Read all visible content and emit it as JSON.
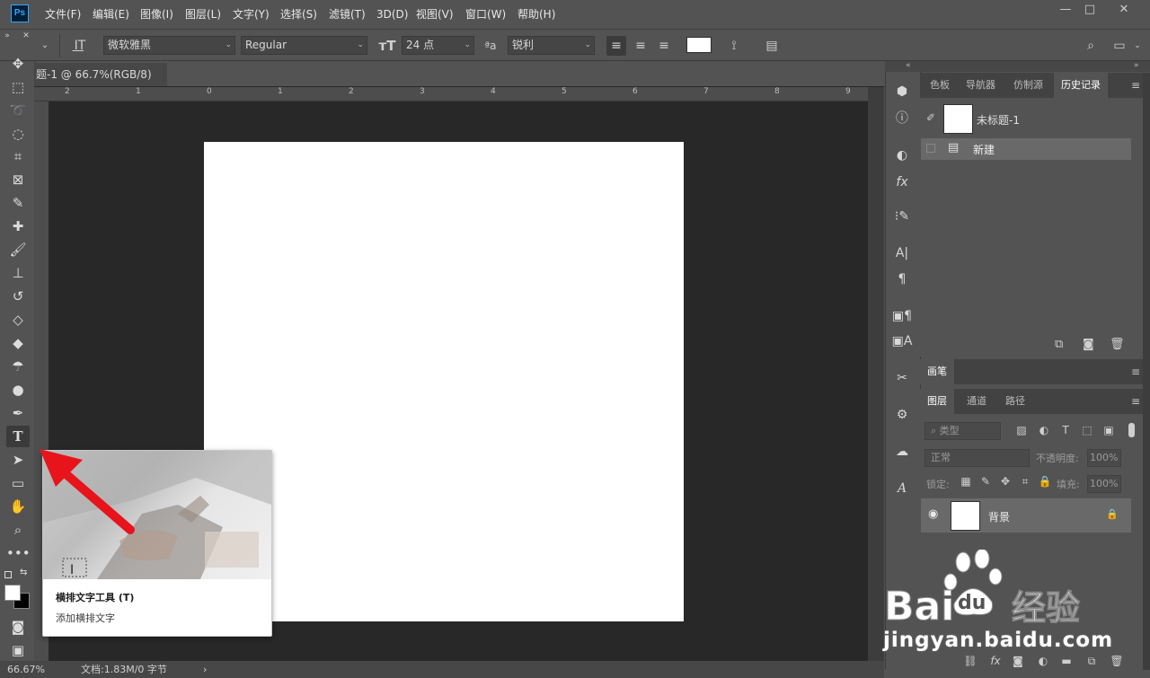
{
  "app": {
    "logo": "Ps"
  },
  "menu": [
    "文件(F)",
    "编辑(E)",
    "图像(I)",
    "图层(L)",
    "文字(Y)",
    "选择(S)",
    "滤镜(T)",
    "3D(D)",
    "视图(V)",
    "窗口(W)",
    "帮助(H)"
  ],
  "window_controls": {
    "minimize": "—",
    "restore": "□",
    "close": "✕"
  },
  "options": {
    "font_family": "微软雅黑",
    "font_style": "Regular",
    "font_size": "24 点",
    "antialias": "锐利",
    "text_color": "#ffffff"
  },
  "document": {
    "tab_title": "题-1 @ 66.7%(RGB/8)",
    "close": "×",
    "ruler_labels": [
      "2",
      "1",
      "0",
      "1",
      "2",
      "3",
      "4",
      "5",
      "6",
      "7",
      "8",
      "9"
    ],
    "canvas_color": "#ffffff"
  },
  "status": {
    "zoom": "66.67%",
    "doc_info": "文档:1.83M/0 字节",
    "arrow": "›"
  },
  "history_panel": {
    "tabs": [
      "色板",
      "导航器",
      "仿制源",
      "历史记录"
    ],
    "active_tab": "历史记录",
    "snapshot_label": "未标题-1",
    "states": [
      "新建"
    ]
  },
  "brush_panel": {
    "tabs": [
      "画笔"
    ]
  },
  "layers_panel": {
    "tabs": [
      "图层",
      "通道",
      "路径"
    ],
    "active_tab": "图层",
    "filter_placeholder": "类型",
    "blend_mode": "正常",
    "opacity_label": "不透明度:",
    "opacity_value": "100%",
    "lock_label": "锁定:",
    "fill_label": "填充:",
    "fill_value": "100%",
    "layers": [
      {
        "name": "背景",
        "visible": true,
        "locked": true
      }
    ]
  },
  "tooltip": {
    "title": "横排文字工具 (T)",
    "description": "添加横排文字"
  },
  "watermark": {
    "brand": "Bai",
    "brand_suffix": "du",
    "brand_cn": "经验",
    "url": "jingyan.baidu.com"
  },
  "colors": {
    "ui_bg": "#535353",
    "canvas_bg": "#282828",
    "arrow": "#e8141b"
  }
}
